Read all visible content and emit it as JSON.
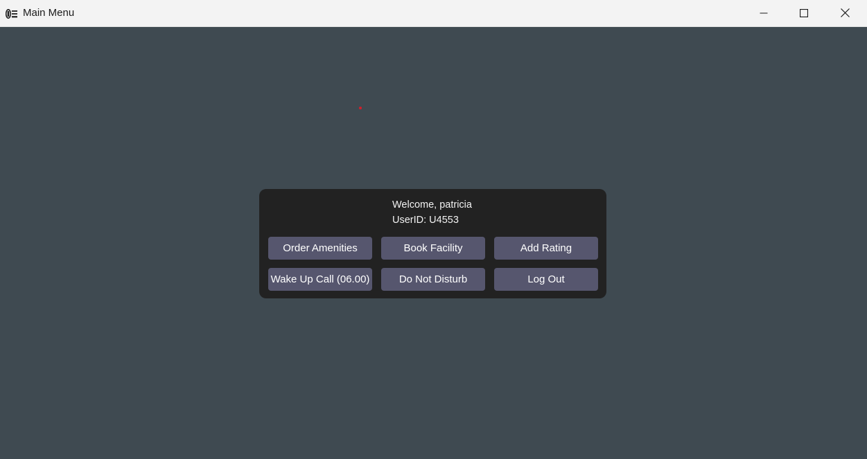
{
  "window": {
    "title": "Main Menu",
    "icon": "hotel-logo-icon",
    "controls": [
      "minimize-icon",
      "maximize-icon",
      "close-icon"
    ]
  },
  "panel": {
    "welcome": "Welcome, patricia",
    "user_id": "UserID: U4553",
    "buttons": [
      {
        "label": "Order Amenities"
      },
      {
        "label": "Book Facility"
      },
      {
        "label": "Add Rating"
      },
      {
        "label": "Wake Up Call (06.00)"
      },
      {
        "label": "Do Not Disturb"
      },
      {
        "label": "Log Out"
      }
    ]
  },
  "colors": {
    "background": "#3f4a51",
    "panel": "#222222",
    "button": "#56566e",
    "text": "#ffffff",
    "titlebar": "#f3f3f3",
    "marker": "#d21f2b"
  }
}
